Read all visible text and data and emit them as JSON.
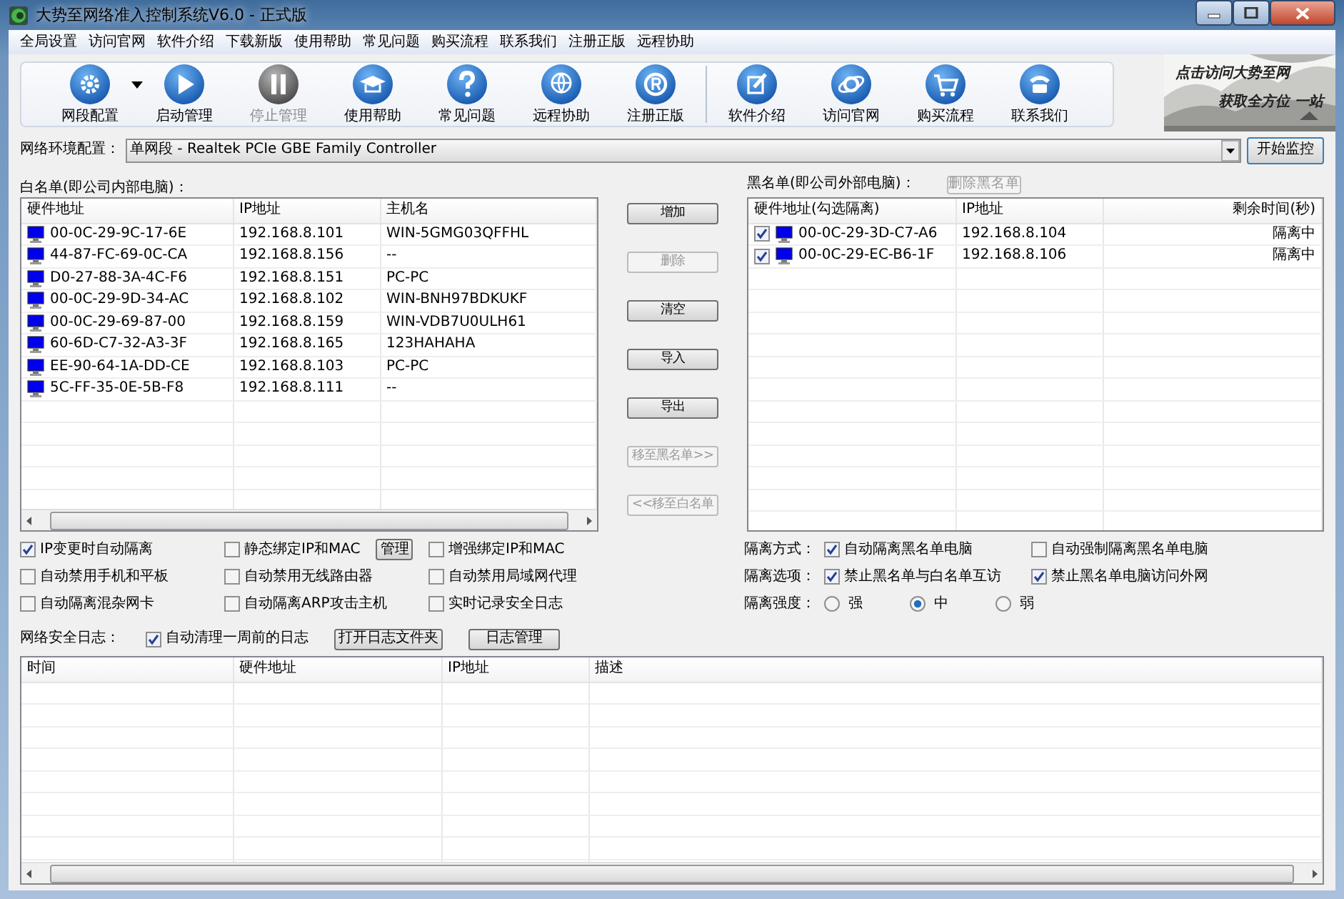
{
  "window": {
    "title": "大势至网络准入控制系统V6.0 - 正式版"
  },
  "menu": [
    "全局设置",
    "访问官网",
    "软件介绍",
    "下载新版",
    "使用帮助",
    "常见问题",
    "购买流程",
    "联系我们",
    "注册正版",
    "远程协助"
  ],
  "toolbar": [
    {
      "kind": "button",
      "label": "网段配置",
      "disabled": false,
      "dropdown": true
    },
    {
      "kind": "button",
      "label": "启动管理",
      "disabled": false,
      "dropdown": false
    },
    {
      "kind": "button",
      "label": "停止管理",
      "disabled": true,
      "dropdown": false
    },
    {
      "kind": "button",
      "label": "使用帮助",
      "disabled": false,
      "dropdown": false
    },
    {
      "kind": "button",
      "label": "常见问题",
      "disabled": false,
      "dropdown": false
    },
    {
      "kind": "button",
      "label": "远程协助",
      "disabled": false,
      "dropdown": false
    },
    {
      "kind": "button",
      "label": "注册正版",
      "disabled": false,
      "dropdown": false
    },
    {
      "kind": "separator"
    },
    {
      "kind": "button",
      "label": "软件介绍",
      "disabled": false,
      "dropdown": false
    },
    {
      "kind": "button",
      "label": "访问官网",
      "disabled": false,
      "dropdown": false
    },
    {
      "kind": "button",
      "label": "购买流程",
      "disabled": false,
      "dropdown": false
    },
    {
      "kind": "button",
      "label": "联系我们",
      "disabled": false,
      "dropdown": false
    }
  ],
  "banner": {
    "lines": [
      "点击访问大势至网",
      "获取全方位 一站"
    ]
  },
  "network": {
    "label": "网络环境配置：",
    "value": "单网段 - Realtek PCIe GBE Family Controller",
    "button": "开始监控"
  },
  "whitelist": {
    "label": "白名单(即公司内部电脑)：",
    "columns": [
      "硬件地址",
      "IP地址",
      "主机名"
    ],
    "rows": [
      {
        "mac": "00-0C-29-9C-17-6E",
        "ip": "192.168.8.101",
        "host": "WIN-5GMG03QFFHL"
      },
      {
        "mac": "44-87-FC-69-0C-CA",
        "ip": "192.168.8.156",
        "host": "--"
      },
      {
        "mac": "D0-27-88-3A-4C-F6",
        "ip": "192.168.8.151",
        "host": "PC-PC"
      },
      {
        "mac": "00-0C-29-9D-34-AC",
        "ip": "192.168.8.102",
        "host": "WIN-BNH97BDKUKF"
      },
      {
        "mac": "00-0C-29-69-87-00",
        "ip": "192.168.8.159",
        "host": "WIN-VDB7U0ULH61"
      },
      {
        "mac": "60-6D-C7-32-A3-3F",
        "ip": "192.168.8.165",
        "host": "123HAHAHA"
      },
      {
        "mac": "EE-90-64-1A-DD-CE",
        "ip": "192.168.8.103",
        "host": "PC-PC"
      },
      {
        "mac": "5C-FF-35-0E-5B-F8",
        "ip": "192.168.8.111",
        "host": "--"
      }
    ]
  },
  "middle_buttons": [
    {
      "label": "增加",
      "disabled": false
    },
    {
      "label": "删除",
      "disabled": true
    },
    {
      "label": "清空",
      "disabled": false
    },
    {
      "label": "导入",
      "disabled": false
    },
    {
      "label": "导出",
      "disabled": false
    },
    {
      "label": "移至黑名单>>",
      "disabled": true
    },
    {
      "label": "<<移至白名单",
      "disabled": true
    }
  ],
  "blacklist": {
    "label": "黑名单(即公司外部电脑)：",
    "delete_button": {
      "label": "删除黑名单",
      "disabled": true
    },
    "columns": [
      "硬件地址(勾选隔离)",
      "IP地址",
      "剩余时间(秒)"
    ],
    "rows": [
      {
        "checked": true,
        "mac": "00-0C-29-3D-C7-A6",
        "ip": "192.168.8.104",
        "remaining": "隔离中"
      },
      {
        "checked": true,
        "mac": "00-0C-29-EC-B6-1F",
        "ip": "192.168.8.106",
        "remaining": "隔离中"
      }
    ]
  },
  "options": [
    {
      "label": "IP变更时自动隔离",
      "checked": true
    },
    {
      "label": "静态绑定IP和MAC",
      "checked": false
    },
    {
      "label": "增强绑定IP和MAC",
      "checked": false
    },
    {
      "label": "自动禁用手机和平板",
      "checked": false
    },
    {
      "label": "自动禁用无线路由器",
      "checked": false
    },
    {
      "label": "自动禁用局域网代理",
      "checked": false
    },
    {
      "label": "自动隔离混杂网卡",
      "checked": false
    },
    {
      "label": "自动隔离ARP攻击主机",
      "checked": false
    },
    {
      "label": "实时记录安全日志",
      "checked": false
    }
  ],
  "manage_button": "管理",
  "isolation": {
    "method_label": "隔离方式：",
    "methods": [
      {
        "label": "自动隔离黑名单电脑",
        "checked": true
      },
      {
        "label": "自动强制隔离黑名单电脑",
        "checked": false
      }
    ],
    "options_label": "隔离选项：",
    "options": [
      {
        "label": "禁止黑名单与白名单互访",
        "checked": true
      },
      {
        "label": "禁止黑名单电脑访问外网",
        "checked": true
      }
    ],
    "strength_label": "隔离强度：",
    "strengths": [
      {
        "label": "强",
        "selected": false
      },
      {
        "label": "中",
        "selected": true
      },
      {
        "label": "弱",
        "selected": false
      }
    ]
  },
  "log": {
    "label": "网络安全日志：",
    "auto_clean": {
      "label": "自动清理一周前的日志",
      "checked": true
    },
    "buttons": [
      "打开日志文件夹",
      "日志管理"
    ],
    "columns": [
      "时间",
      "硬件地址",
      "IP地址",
      "描述"
    ]
  }
}
